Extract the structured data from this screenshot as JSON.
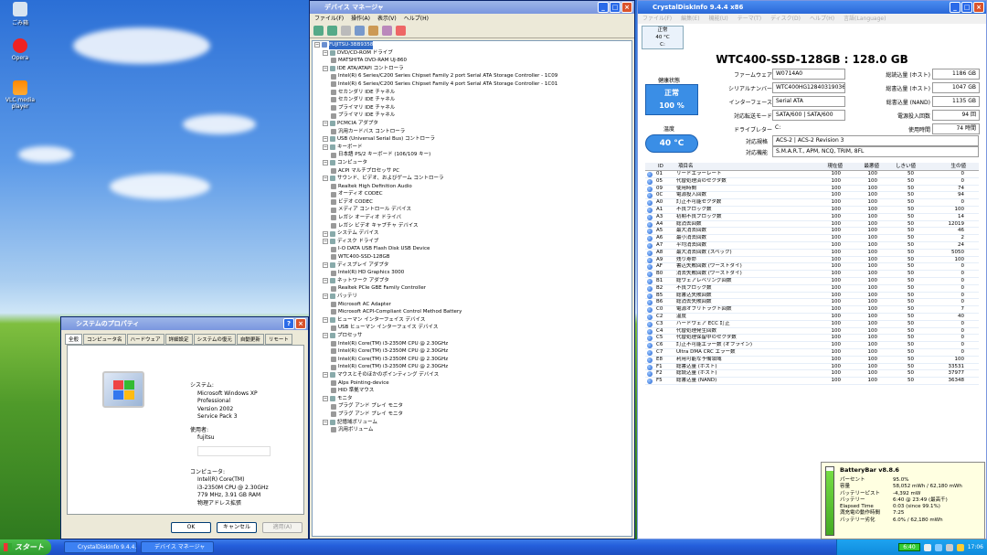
{
  "desktop": {
    "icons": [
      {
        "label": "ごみ箱"
      },
      {
        "label": "Opera"
      },
      {
        "label": "VLC media player"
      }
    ]
  },
  "devmgr": {
    "title": "デバイス マネージャ",
    "menu": [
      "ファイル(F)",
      "操作(A)",
      "表示(V)",
      "ヘルプ(H)"
    ],
    "tree": [
      {
        "t": "FUJITSU-3BB9358",
        "l": 0,
        "root": true
      },
      {
        "t": "DVD/CD-ROM ドライブ",
        "l": 1
      },
      {
        "t": "MATSHITA DVD-RAM UJ-860",
        "l": 2
      },
      {
        "t": "IDE ATA/ATAPI コントローラ",
        "l": 1
      },
      {
        "t": "Intel(R) 6 Series/C200 Series Chipset Family 2 port Serial ATA Storage Controller - 1C09",
        "l": 2
      },
      {
        "t": "Intel(R) 6 Series/C200 Series Chipset Family 4 port Serial ATA Storage Controller - 1C01",
        "l": 2
      },
      {
        "t": "セカンダリ IDE チャネル",
        "l": 2
      },
      {
        "t": "セカンダリ IDE チャネル",
        "l": 2
      },
      {
        "t": "プライマリ IDE チャネル",
        "l": 2
      },
      {
        "t": "プライマリ IDE チャネル",
        "l": 2
      },
      {
        "t": "PCMCIA アダプタ",
        "l": 1
      },
      {
        "t": "汎用カードバス コントローラ",
        "l": 2
      },
      {
        "t": "USB (Universal Serial Bus) コントローラ",
        "l": 1
      },
      {
        "t": "キーボード",
        "l": 1
      },
      {
        "t": "日本語 PS/2 キーボード (106/109 キー)",
        "l": 2
      },
      {
        "t": "コンピュータ",
        "l": 1
      },
      {
        "t": "ACPI マルチプロセッサ PC",
        "l": 2
      },
      {
        "t": "サウンド、ビデオ、およびゲーム コントローラ",
        "l": 1
      },
      {
        "t": "Realtek High Definition Audio",
        "l": 2
      },
      {
        "t": "オーディオ CODEC",
        "l": 2
      },
      {
        "t": "ビデオ CODEC",
        "l": 2
      },
      {
        "t": "メディア コントロール デバイス",
        "l": 2
      },
      {
        "t": "レガシ オーディオ ドライバ",
        "l": 2
      },
      {
        "t": "レガシ ビデオ キャプチャ デバイス",
        "l": 2
      },
      {
        "t": "システム デバイス",
        "l": 1
      },
      {
        "t": "ディスク ドライブ",
        "l": 1
      },
      {
        "t": "I-O DATA USB Flash Disk USB Device",
        "l": 2
      },
      {
        "t": "WTC400-SSD-128GB",
        "l": 2
      },
      {
        "t": "ディスプレイ アダプタ",
        "l": 1
      },
      {
        "t": "Intel(R) HD Graphics 3000",
        "l": 2
      },
      {
        "t": "ネットワーク アダプタ",
        "l": 1
      },
      {
        "t": "Realtek PCIe GBE Family Controller",
        "l": 2
      },
      {
        "t": "バッテリ",
        "l": 1
      },
      {
        "t": "Microsoft AC Adapter",
        "l": 2
      },
      {
        "t": "Microsoft ACPI-Compliant Control Method Battery",
        "l": 2
      },
      {
        "t": "ヒューマン インターフェイス デバイス",
        "l": 1
      },
      {
        "t": "USB ヒューマン インターフェイス デバイス",
        "l": 2
      },
      {
        "t": "プロセッサ",
        "l": 1
      },
      {
        "t": "Intel(R) Core(TM) i3-2350M CPU @ 2.30GHz",
        "l": 2
      },
      {
        "t": "Intel(R) Core(TM) i3-2350M CPU @ 2.30GHz",
        "l": 2
      },
      {
        "t": "Intel(R) Core(TM) i3-2350M CPU @ 2.30GHz",
        "l": 2
      },
      {
        "t": "Intel(R) Core(TM) i3-2350M CPU @ 2.30GHz",
        "l": 2
      },
      {
        "t": "マウスとそのほかのポインティング デバイス",
        "l": 1
      },
      {
        "t": "Alps Pointing-device",
        "l": 2
      },
      {
        "t": "HID 準拠マウス",
        "l": 2
      },
      {
        "t": "モニタ",
        "l": 1
      },
      {
        "t": "プラグ アンド プレイ モニタ",
        "l": 2
      },
      {
        "t": "プラグ アンド プレイ モニタ",
        "l": 2
      },
      {
        "t": "記憶域ボリューム",
        "l": 1
      },
      {
        "t": "汎用ボリューム",
        "l": 2
      }
    ]
  },
  "sysprop": {
    "title": "システムのプロパティ",
    "tabs": [
      "全般",
      "コンピュータ名",
      "ハードウェア",
      "詳細設定",
      "システムの復元",
      "自動更新",
      "リモート"
    ],
    "system_label": "システム:",
    "system": [
      "Microsoft Windows XP",
      "Professional",
      "Version 2002",
      "Service Pack 3"
    ],
    "user_label": "使用者:",
    "user": "fujitsu",
    "computer_label": "コンピュータ:",
    "computer": [
      "Intel(R) Core(TM)",
      "i3-2350M CPU @ 2.30GHz",
      "779 MHz, 3.91 GB RAM",
      "物理アドレス拡張"
    ],
    "buttons": {
      "ok": "OK",
      "cancel": "キャンセル",
      "apply": "適用(A)"
    }
  },
  "cdi": {
    "title": "CrystalDiskInfo 9.4.4 x86",
    "menu": [
      "ファイル(F)",
      "編集(E)",
      "機能(U)",
      "テーマ(T)",
      "ディスク(D)",
      "ヘルプ(H)",
      "言語(Language)"
    ],
    "tab": {
      "status": "正常",
      "temp": "40 °C",
      "drive": "C:"
    },
    "model": "WTC400-SSD-128GB : 128.0 GB",
    "health_label": "健康状態",
    "health_status": "正常",
    "health_pct": "100 %",
    "temp_label": "温度",
    "temp": "40 °C",
    "left": [
      [
        "ファームウェア",
        "W0714A0"
      ],
      [
        "シリアルナンバー",
        "WTC400HG128403190363"
      ],
      [
        "インターフェース",
        "Serial ATA"
      ],
      [
        "対応転送モード",
        "SATA/600 | SATA/600"
      ],
      [
        "ドライブレター",
        "C:"
      ]
    ],
    "right": [
      [
        "総読込量 (ホスト)",
        "1186 GB"
      ],
      [
        "総書込量 (ホスト)",
        "1047 GB"
      ],
      [
        "総書込量 (NAND)",
        "1135 GB"
      ],
      [
        "電源投入回数",
        "94 回"
      ],
      [
        "使用時間",
        "74 時間"
      ]
    ],
    "std_label": "対応規格",
    "std": "ACS-2 | ACS-2 Revision 3",
    "feat_label": "対応機能",
    "feat": "S.M.A.R.T., APM, NCQ, TRIM, 8FL",
    "headers": [
      "ID",
      "項目名",
      "現在値",
      "最悪値",
      "しきい値",
      "生の値"
    ],
    "rows": [
      [
        "01",
        "リードエラーレート",
        "100",
        "100",
        "50",
        "0"
      ],
      [
        "05",
        "代替処理済のセクタ数",
        "100",
        "100",
        "50",
        "0"
      ],
      [
        "09",
        "使用時間",
        "100",
        "100",
        "50",
        "74"
      ],
      [
        "0C",
        "電源投入回数",
        "100",
        "100",
        "50",
        "94"
      ],
      [
        "A0",
        "訂正不可能セクタ数",
        "100",
        "100",
        "50",
        "0"
      ],
      [
        "A1",
        "不良ブロック数",
        "100",
        "100",
        "50",
        "100"
      ],
      [
        "A3",
        "初期不良ブロック数",
        "100",
        "100",
        "50",
        "14"
      ],
      [
        "A4",
        "総消去回数",
        "100",
        "100",
        "50",
        "12019"
      ],
      [
        "A5",
        "最大消去回数",
        "100",
        "100",
        "50",
        "46"
      ],
      [
        "A6",
        "最小消去回数",
        "100",
        "100",
        "50",
        "2"
      ],
      [
        "A7",
        "平均消去回数",
        "100",
        "100",
        "50",
        "24"
      ],
      [
        "A8",
        "最大消去回数 (スペック)",
        "100",
        "100",
        "50",
        "5050"
      ],
      [
        "A9",
        "残り寿命",
        "100",
        "100",
        "50",
        "100"
      ],
      [
        "AF",
        "書込失敗回数 (ワーストダイ)",
        "100",
        "100",
        "50",
        "0"
      ],
      [
        "B0",
        "消去失敗回数 (ワーストダイ)",
        "100",
        "100",
        "50",
        "0"
      ],
      [
        "B1",
        "総ウェアレベリング回数",
        "100",
        "100",
        "50",
        "0"
      ],
      [
        "B2",
        "不良ブロック数",
        "100",
        "100",
        "50",
        "0"
      ],
      [
        "B5",
        "総書込失敗回数",
        "100",
        "100",
        "50",
        "0"
      ],
      [
        "B6",
        "総消去失敗回数",
        "100",
        "100",
        "50",
        "0"
      ],
      [
        "C0",
        "電源オフリトラクト回数",
        "100",
        "100",
        "50",
        "7"
      ],
      [
        "C2",
        "温度",
        "100",
        "100",
        "50",
        "40"
      ],
      [
        "C3",
        "ハードウェア ECC 訂正",
        "100",
        "100",
        "50",
        "0"
      ],
      [
        "C4",
        "代替処理発生回数",
        "100",
        "100",
        "50",
        "0"
      ],
      [
        "C5",
        "代替処理保留中のセクタ数",
        "100",
        "100",
        "50",
        "0"
      ],
      [
        "C6",
        "訂正不可能エラー数 (オフライン)",
        "100",
        "100",
        "50",
        "0"
      ],
      [
        "C7",
        "Ultra DMA CRC エラー数",
        "100",
        "100",
        "50",
        "0"
      ],
      [
        "E8",
        "利用可能な予備領域",
        "100",
        "100",
        "50",
        "100"
      ],
      [
        "F1",
        "総書込量 (ホスト)",
        "100",
        "100",
        "50",
        "33531"
      ],
      [
        "F2",
        "総読込量 (ホスト)",
        "100",
        "100",
        "50",
        "37977"
      ],
      [
        "F5",
        "総書込量 (NAND)",
        "100",
        "100",
        "50",
        "36348"
      ]
    ]
  },
  "battery": {
    "title": "BatteryBar v8.8.6",
    "rows": [
      [
        "パーセント",
        "95.0%"
      ],
      [
        "容量",
        "58,052 mWh / 62,180 mWh"
      ],
      [
        "バッテリーピスト",
        "-4,392 mW"
      ],
      [
        "バッテリー",
        "6:40 @ 23:49 (最高千)"
      ],
      [
        "Elapsed Time",
        "0:03 (since 99.1%)"
      ],
      [
        "満充電の動作時間",
        "7:25"
      ],
      [
        "バッテリー劣化",
        "6.0% / 62,180 mWh"
      ]
    ]
  },
  "taskbar": {
    "start": "スタート",
    "tasks": [
      "CrystalDiskInfo 9.4.4...",
      "デバイス マネージャ"
    ],
    "battery": "6:40",
    "clock": "17:06"
  },
  "colors": {
    "health": "#3a8ee6",
    "temp": "#3a8ee6"
  }
}
